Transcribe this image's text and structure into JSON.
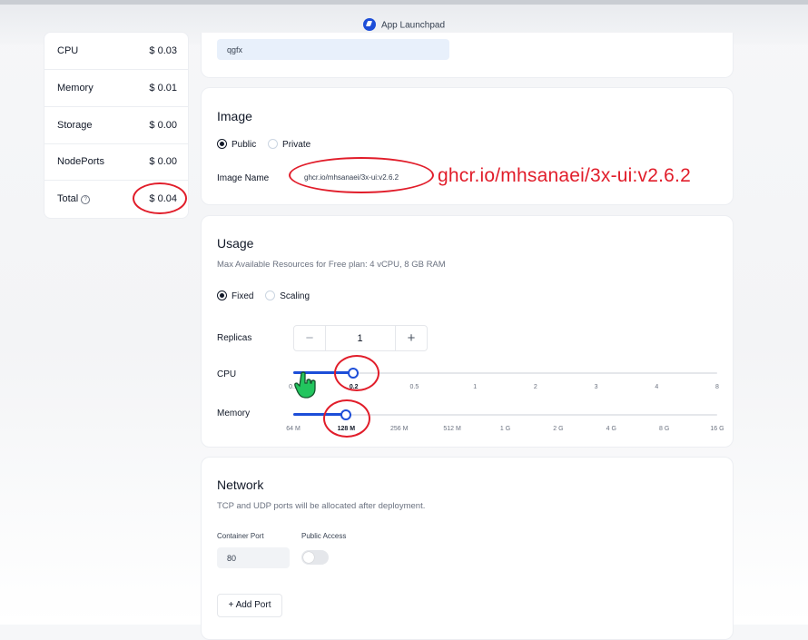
{
  "window": {
    "title": "App Launchpad"
  },
  "costs": {
    "rows": [
      {
        "label": "CPU",
        "value": "$ 0.03"
      },
      {
        "label": "Memory",
        "value": "$ 0.01"
      },
      {
        "label": "Storage",
        "value": "$ 0.00"
      },
      {
        "label": "NodePorts",
        "value": "$ 0.00"
      },
      {
        "label": "Total",
        "value": "$ 0.04"
      }
    ]
  },
  "app_name": {
    "value": "qgfx"
  },
  "image": {
    "title": "Image",
    "public_label": "Public",
    "private_label": "Private",
    "selected": "Public",
    "image_name_label": "Image Name",
    "image_name_value": "ghcr.io/mhsanaei/3x-ui:v2.6.2",
    "annotation_text": "ghcr.io/mhsanaei/3x-ui:v2.6.2"
  },
  "usage": {
    "title": "Usage",
    "subtitle": "Max Available Resources for Free plan: 4 vCPU, 8 GB RAM",
    "fixed_label": "Fixed",
    "scaling_label": "Scaling",
    "selected": "Fixed",
    "replicas_label": "Replicas",
    "replicas_value": "1",
    "cpu_label": "CPU",
    "cpu_ticks": [
      "0.1",
      "0.2",
      "0.5",
      "1",
      "2",
      "3",
      "4",
      "8"
    ],
    "cpu_selected": "0.2",
    "memory_label": "Memory",
    "memory_ticks": [
      "64 M",
      "128 M",
      "256 M",
      "512 M",
      "1 G",
      "2 G",
      "4 G",
      "8 G",
      "16 G"
    ],
    "memory_selected": "128 M"
  },
  "network": {
    "title": "Network",
    "subtitle": "TCP and UDP ports will be allocated after deployment.",
    "container_port_label": "Container Port",
    "public_access_label": "Public Access",
    "container_port_value": "80",
    "public_access_enabled": false,
    "add_port_label": "+ Add Port"
  },
  "colors": {
    "accent": "#1d4ed8",
    "annotation": "#e11d2a"
  }
}
